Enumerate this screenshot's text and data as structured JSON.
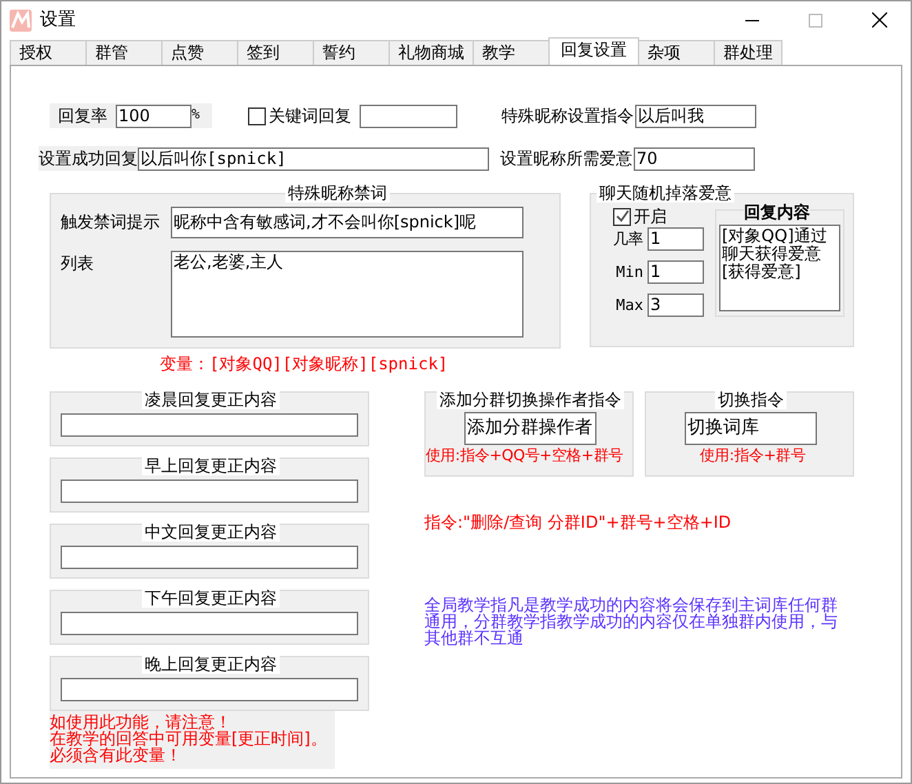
{
  "window": {
    "title": "设置"
  },
  "tabs": [
    {
      "label": "授权",
      "selected": false
    },
    {
      "label": "群管",
      "selected": false
    },
    {
      "label": "点赞",
      "selected": false
    },
    {
      "label": "签到",
      "selected": false
    },
    {
      "label": "誓约",
      "selected": false
    },
    {
      "label": "礼物商城",
      "selected": false
    },
    {
      "label": "教学",
      "selected": false
    },
    {
      "label": "回复设置",
      "selected": true
    },
    {
      "label": "杂项",
      "selected": false
    },
    {
      "label": "群处理",
      "selected": false
    }
  ],
  "reply_rate": {
    "label": "回复率",
    "value": "100",
    "unit": "%"
  },
  "keyword_reply": {
    "label": "关键词回复",
    "checked": false
  },
  "nickname_command": {
    "label": "特殊昵称设置指令",
    "value": "以后叫我"
  },
  "success_reply": {
    "label": "设置成功回复",
    "value": "以后叫你[spnick]"
  },
  "required_affection": {
    "label": "设置昵称所需爱意",
    "value": "70"
  },
  "banned_words": {
    "title": "特殊昵称禁词",
    "prompt_label": "触发禁词提示",
    "prompt_value": "昵称中含有敏感词,才不会叫你[spnick]呢",
    "list_label": "列表",
    "list_value": "老公,老婆,主人"
  },
  "variables_note": "变量：[对象QQ][对象昵称][spnick]",
  "random_affection": {
    "title": "聊天随机掉落爱意",
    "enabled_label": "开启",
    "enabled": true,
    "fields": [
      {
        "label": "几率",
        "value": "1"
      },
      {
        "label": "Min",
        "value": "1"
      },
      {
        "label": "Max",
        "value": "3"
      }
    ],
    "reply_title": "回复内容",
    "reply_value": "[对象QQ]通过聊天获得爱意[获得爱意]"
  },
  "time_replies": [
    {
      "title": "凌晨回复更正内容"
    },
    {
      "title": "早上回复更正内容"
    },
    {
      "title": "中文回复更正内容"
    },
    {
      "title": "下午回复更正内容"
    },
    {
      "title": "晚上回复更正内容"
    }
  ],
  "time_note": [
    "如使用此功能，请注意！",
    "在教学的回答中可用变量[更正时间]。",
    "必须含有此变量！"
  ],
  "add_operator": {
    "title": "添加分群切换操作者指令",
    "value": "添加分群操作者",
    "usage": "使用:指令+QQ号+空格+群号"
  },
  "switch_command": {
    "title": "切换指令",
    "value": "切换词库",
    "usage": "使用:指令+群号"
  },
  "group_id_command": "指令:\"删除/查询 分群ID\"+群号+空格+ID",
  "teaching_note": "全局教学指凡是教学成功的内容将会保存到主词库任何群通用，分群教学指教学成功的内容仅在单独群内使用，与其他群不互通"
}
